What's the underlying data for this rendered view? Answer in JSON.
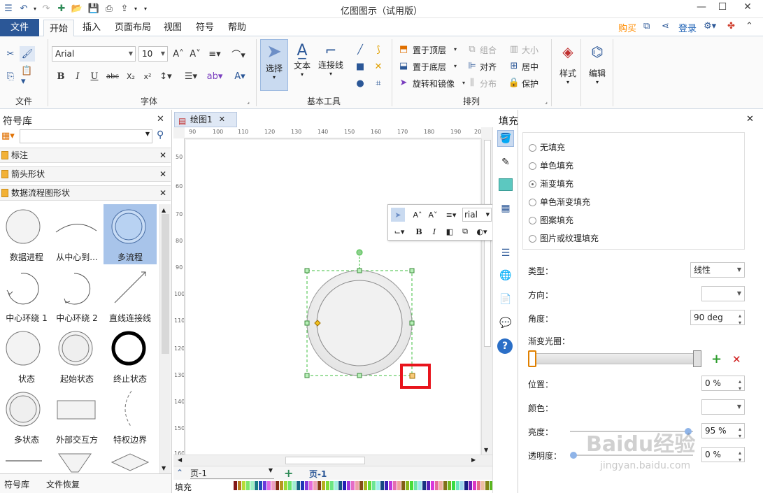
{
  "window": {
    "title": "亿图图示（试用版）"
  },
  "tabs": {
    "file": "文件",
    "items": [
      "开始",
      "插入",
      "页面布局",
      "视图",
      "符号",
      "帮助"
    ],
    "active": "开始",
    "buy": "购买",
    "login": "登录"
  },
  "ribbon": {
    "font_name": "Arial",
    "font_size": "10",
    "groups": {
      "file": "文件",
      "font": "字体",
      "basic_tools": "基本工具",
      "arrange": "排列"
    },
    "select": "选择",
    "text": "文本",
    "connector": "连接线",
    "bring_top": "置于顶层",
    "send_bottom": "置于底层",
    "rotate_mirror": "旋转和镜像",
    "group": "组合",
    "align": "对齐",
    "distribute": "分布",
    "size": "大小",
    "center": "居中",
    "protect": "保护",
    "style": "样式",
    "edit": "编辑"
  },
  "symbol_panel": {
    "title": "符号库",
    "categories": [
      "标注",
      "箭头形状",
      "数据流程图形状"
    ],
    "symbols": [
      {
        "label": "数据进程"
      },
      {
        "label": "从中心到..."
      },
      {
        "label": "多流程"
      },
      {
        "label": "中心环绕 1"
      },
      {
        "label": "中心环绕 2"
      },
      {
        "label": "直线连接线"
      },
      {
        "label": "状态"
      },
      {
        "label": "起始状态"
      },
      {
        "label": "终止状态"
      },
      {
        "label": "多状态"
      },
      {
        "label": "外部交互方"
      },
      {
        "label": "特权边界"
      }
    ],
    "selected": "多流程",
    "bottom_tabs": [
      "符号库",
      "文件恢复"
    ]
  },
  "document": {
    "tab": "绘图1",
    "hruler": [
      "90",
      "100",
      "110",
      "120",
      "130",
      "140",
      "150",
      "160",
      "170",
      "180",
      "190",
      "200"
    ],
    "vruler": [
      "50",
      "60",
      "70",
      "80",
      "90",
      "100",
      "110",
      "120",
      "130",
      "140",
      "150",
      "160"
    ],
    "page_combo": "页-1",
    "page_tab": "页-1",
    "fill_label": "填充"
  },
  "mini_toolbar": {
    "font": "rial"
  },
  "fill_panel": {
    "title": "填充",
    "options": [
      "无填充",
      "单色填充",
      "渐变填充",
      "单色渐变填充",
      "图案填充",
      "图片或纹理填充"
    ],
    "selected": "渐变填充",
    "type_label": "类型：",
    "type_value": "线性",
    "direction_label": "方向：",
    "angle_label": "角度：",
    "angle_value": "90 deg",
    "gradient_label": "渐变光圈：",
    "position_label": "位置：",
    "position_value": "0 %",
    "color_label": "颜色：",
    "brightness_label": "亮度：",
    "brightness_value": "95 %",
    "transparency_label": "透明度：",
    "transparency_value": "0 %"
  },
  "watermark": {
    "text": "Baidu经验",
    "sub": "jingyan.baidu.com"
  },
  "colors": {
    "file_tab": "#2b5797",
    "accent_orange": "#ff8c00",
    "login_blue": "#1a5fb4",
    "selection_green": "#3fbf3f",
    "highlight_red": "#e8141c"
  }
}
